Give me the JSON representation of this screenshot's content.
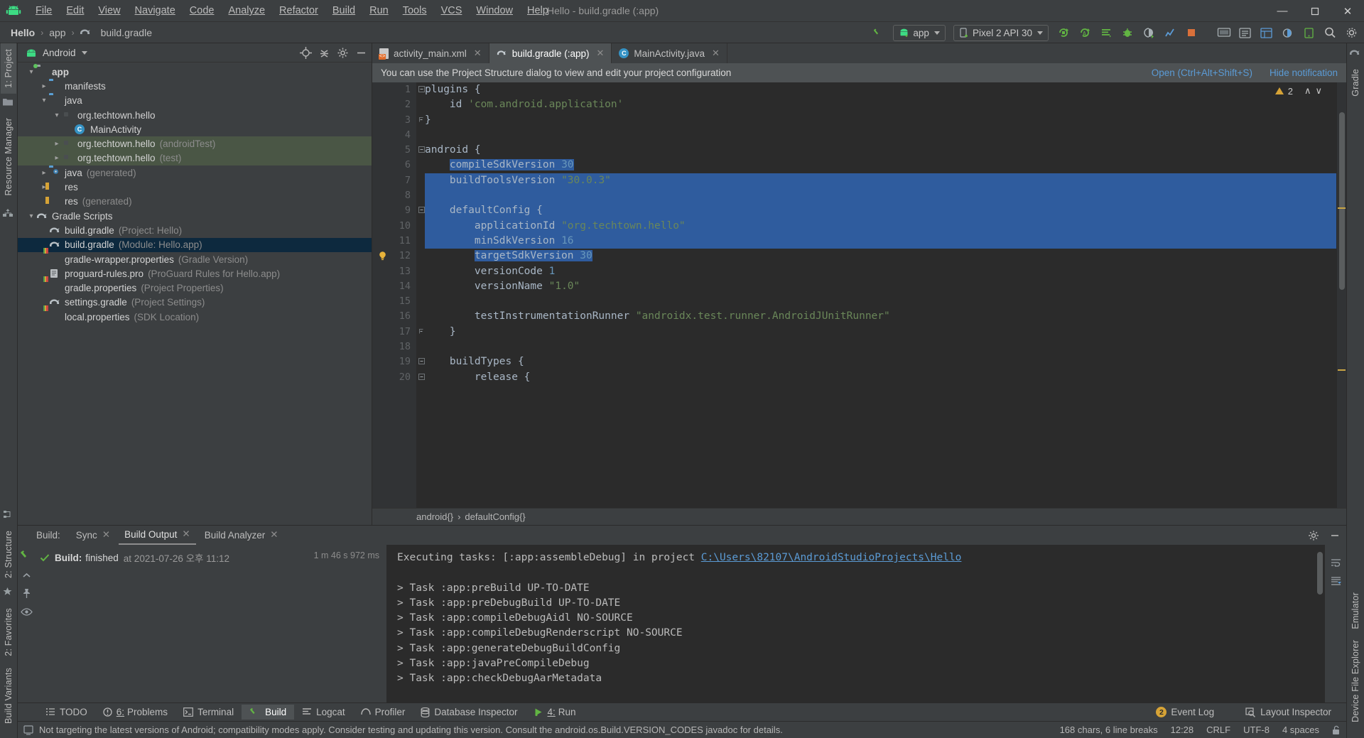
{
  "window": {
    "title": "Hello - build.gradle (:app)",
    "minimize": "─",
    "maximize": "☐",
    "close": "✕"
  },
  "menubar": {
    "logo_icon": "android-logo-icon",
    "items": [
      {
        "label": "File",
        "mnemonic": "F"
      },
      {
        "label": "Edit",
        "mnemonic": "E"
      },
      {
        "label": "View",
        "mnemonic": "V"
      },
      {
        "label": "Navigate",
        "mnemonic": "N"
      },
      {
        "label": "Code",
        "mnemonic": "C"
      },
      {
        "label": "Analyze",
        "mnemonic": "y"
      },
      {
        "label": "Refactor",
        "mnemonic": "R"
      },
      {
        "label": "Build",
        "mnemonic": "B"
      },
      {
        "label": "Run",
        "mnemonic": "u"
      },
      {
        "label": "Tools",
        "mnemonic": "T"
      },
      {
        "label": "VCS",
        "mnemonic": "S"
      },
      {
        "label": "Window",
        "mnemonic": "W"
      },
      {
        "label": "Help",
        "mnemonic": "H"
      }
    ]
  },
  "navbar": {
    "breadcrumbs": [
      {
        "label": "Hello",
        "icon": ""
      },
      {
        "label": "app",
        "icon": ""
      },
      {
        "label": "build.gradle",
        "icon": "gradle-icon"
      }
    ],
    "separator": "›",
    "module_selector": "app",
    "device_selector": "Pixel 2 API 30",
    "icons": [
      "make-project-icon",
      "run-icon",
      "debug-icon",
      "run-with-coverage-icon",
      "profiler-icon",
      "apply-changes-icon",
      "apply-code-changes-icon",
      "stop-icon",
      "avd-manager-icon",
      "sdk-manager-icon",
      "search-icon"
    ]
  },
  "left_strip": {
    "tabs": [
      {
        "label": "1: Project",
        "active": true
      },
      {
        "label": "Resource Manager",
        "active": false
      }
    ],
    "bottom_tabs": [
      {
        "label": "2: Structure"
      },
      {
        "label": "2: Favorites"
      },
      {
        "label": "Build Variants"
      }
    ]
  },
  "right_strip": {
    "tabs": [
      {
        "label": "Gradle"
      },
      {
        "label": "Emulator"
      },
      {
        "label": "Device File Explorer"
      }
    ]
  },
  "project_panel": {
    "scope": "Android",
    "scope_icon": "android-logo-icon",
    "header_icons": [
      "target-icon",
      "collapse-all-icon",
      "settings-gear-icon",
      "hide-icon"
    ],
    "tree": [
      {
        "indent": 0,
        "arrow": "down",
        "icon": "folder-module-icon",
        "label": "app",
        "bold": true,
        "sub": "",
        "state": "normal"
      },
      {
        "indent": 1,
        "arrow": "right",
        "icon": "folder-icon",
        "label": "manifests",
        "bold": false,
        "sub": "",
        "state": "normal"
      },
      {
        "indent": 1,
        "arrow": "down",
        "icon": "folder-icon",
        "label": "java",
        "bold": false,
        "sub": "",
        "state": "normal"
      },
      {
        "indent": 2,
        "arrow": "down",
        "icon": "package-icon",
        "label": "org.techtown.hello",
        "bold": false,
        "sub": "",
        "state": "normal"
      },
      {
        "indent": 3,
        "arrow": "none",
        "icon": "java-class-icon",
        "label": "MainActivity",
        "bold": false,
        "sub": "",
        "state": "normal"
      },
      {
        "indent": 2,
        "arrow": "right",
        "icon": "package-icon",
        "label": "org.techtown.hello",
        "bold": false,
        "sub": "(androidTest)",
        "state": "testsrc"
      },
      {
        "indent": 2,
        "arrow": "right",
        "icon": "package-icon",
        "label": "org.techtown.hello",
        "bold": false,
        "sub": "(test)",
        "state": "testsrc"
      },
      {
        "indent": 1,
        "arrow": "right",
        "icon": "folder-generated-icon",
        "label": "java",
        "bold": false,
        "sub": "(generated)",
        "state": "normal"
      },
      {
        "indent": 1,
        "arrow": "right",
        "icon": "res-folder-icon",
        "label": "res",
        "bold": false,
        "sub": "",
        "state": "normal"
      },
      {
        "indent": 1,
        "arrow": "none",
        "icon": "res-folder-icon",
        "label": "res",
        "bold": false,
        "sub": "(generated)",
        "state": "normal"
      },
      {
        "indent": 0,
        "arrow": "down",
        "icon": "gradle-icon",
        "label": "Gradle Scripts",
        "bold": false,
        "sub": "",
        "state": "normal"
      },
      {
        "indent": 1,
        "arrow": "none",
        "icon": "gradle-icon",
        "label": "build.gradle",
        "bold": false,
        "sub": "(Project: Hello)",
        "state": "normal"
      },
      {
        "indent": 1,
        "arrow": "none",
        "icon": "gradle-icon",
        "label": "build.gradle",
        "bold": false,
        "sub": "(Module: Hello.app)",
        "state": "selected"
      },
      {
        "indent": 1,
        "arrow": "none",
        "icon": "properties-icon",
        "label": "gradle-wrapper.properties",
        "bold": false,
        "sub": "(Gradle Version)",
        "state": "normal"
      },
      {
        "indent": 1,
        "arrow": "none",
        "icon": "proguard-icon",
        "label": "proguard-rules.pro",
        "bold": false,
        "sub": "(ProGuard Rules for Hello.app)",
        "state": "normal"
      },
      {
        "indent": 1,
        "arrow": "none",
        "icon": "properties-icon",
        "label": "gradle.properties",
        "bold": false,
        "sub": "(Project Properties)",
        "state": "normal"
      },
      {
        "indent": 1,
        "arrow": "none",
        "icon": "gradle-icon",
        "label": "settings.gradle",
        "bold": false,
        "sub": "(Project Settings)",
        "state": "normal"
      },
      {
        "indent": 1,
        "arrow": "none",
        "icon": "properties-icon",
        "label": "local.properties",
        "bold": false,
        "sub": "(SDK Location)",
        "state": "normal"
      }
    ]
  },
  "editor": {
    "tabs": [
      {
        "label": "activity_main.xml",
        "icon": "xml-layout-icon",
        "active": false
      },
      {
        "label": "build.gradle (:app)",
        "icon": "gradle-icon",
        "active": true
      },
      {
        "label": "MainActivity.java",
        "icon": "java-class-icon",
        "active": false
      }
    ],
    "close_glyph": "✕",
    "notification": {
      "text": "You can use the Project Structure dialog to view and edit your project configuration",
      "open_action": "Open (Ctrl+Alt+Shift+S)",
      "hide_action": "Hide notification"
    },
    "inspection": {
      "warning_count": "2",
      "up_glyph": "∧",
      "down_glyph": "∨"
    },
    "lines": [
      {
        "n": 1,
        "text": "plugins {",
        "fold": "open",
        "sel": false
      },
      {
        "n": 2,
        "text": "    id 'com.android.application'",
        "fold": "",
        "sel": false
      },
      {
        "n": 3,
        "text": "}",
        "fold": "close",
        "sel": false
      },
      {
        "n": 4,
        "text": "",
        "fold": "",
        "sel": false
      },
      {
        "n": 5,
        "text": "android {",
        "fold": "open",
        "sel": false
      },
      {
        "n": 6,
        "text": "    compileSdkVersion 30",
        "fold": "",
        "sel": true
      },
      {
        "n": 7,
        "text": "    buildToolsVersion \"30.0.3\"",
        "fold": "",
        "sel": true
      },
      {
        "n": 8,
        "text": "",
        "fold": "",
        "sel": true
      },
      {
        "n": 9,
        "text": "    defaultConfig {",
        "fold": "open",
        "sel": true
      },
      {
        "n": 10,
        "text": "        applicationId \"org.techtown.hello\"",
        "fold": "",
        "sel": true
      },
      {
        "n": 11,
        "text": "        minSdkVersion 16",
        "fold": "",
        "sel": true
      },
      {
        "n": 12,
        "text": "        targetSdkVersion 30",
        "fold": "",
        "sel": true,
        "bulb": true
      },
      {
        "n": 13,
        "text": "        versionCode 1",
        "fold": "",
        "sel": false
      },
      {
        "n": 14,
        "text": "        versionName \"1.0\"",
        "fold": "",
        "sel": false
      },
      {
        "n": 15,
        "text": "",
        "fold": "",
        "sel": false
      },
      {
        "n": 16,
        "text": "        testInstrumentationRunner \"androidx.test.runner.AndroidJUnitRunner\"",
        "fold": "",
        "sel": false
      },
      {
        "n": 17,
        "text": "    }",
        "fold": "close",
        "sel": false
      },
      {
        "n": 18,
        "text": "",
        "fold": "",
        "sel": false
      },
      {
        "n": 19,
        "text": "    buildTypes {",
        "fold": "open",
        "sel": false
      },
      {
        "n": 20,
        "text": "        release {",
        "fold": "open",
        "sel": false
      }
    ],
    "breadcrumbs": [
      "android{}",
      "defaultConfig{}"
    ],
    "breadcrumb_sep": "›"
  },
  "build_panel": {
    "title": "Build:",
    "tabs": [
      {
        "label": "Sync",
        "active": false,
        "closable": true
      },
      {
        "label": "Build Output",
        "active": true,
        "closable": true
      },
      {
        "label": "Build Analyzer",
        "active": false,
        "closable": true
      }
    ],
    "close_glyph": "✕",
    "header_icons": [
      "settings-gear-icon",
      "minimize-icon"
    ],
    "result": {
      "status_icon": "check-icon",
      "prefix": "Build:",
      "label": "finished",
      "detail": "at 2021-07-26 오후 11:12",
      "duration": "1 m 46 s 972 ms"
    },
    "side_icons": [
      "build-hammer-icon",
      "collapse-icon",
      "pin-icon",
      "eye-icon"
    ],
    "console": [
      {
        "text": "Executing tasks: [:app:assembleDebug] in project ",
        "url": "C:\\Users\\82107\\AndroidStudioProjects\\Hello"
      },
      {
        "text": "",
        "url": ""
      },
      {
        "text": "> Task :app:preBuild UP-TO-DATE",
        "url": ""
      },
      {
        "text": "> Task :app:preDebugBuild UP-TO-DATE",
        "url": ""
      },
      {
        "text": "> Task :app:compileDebugAidl NO-SOURCE",
        "url": ""
      },
      {
        "text": "> Task :app:compileDebugRenderscript NO-SOURCE",
        "url": ""
      },
      {
        "text": "> Task :app:generateDebugBuildConfig",
        "url": ""
      },
      {
        "text": "> Task :app:javaPreCompileDebug",
        "url": ""
      },
      {
        "text": "> Task :app:checkDebugAarMetadata",
        "url": ""
      }
    ],
    "console_right_icons": [
      "wrap-text-icon",
      "scroll-to-end-icon"
    ]
  },
  "bottom_bar": {
    "windows": [
      {
        "label": "TODO",
        "icon": "todo-icon",
        "active": false,
        "prefix": ""
      },
      {
        "label": "Problems",
        "icon": "problems-icon",
        "active": false,
        "prefix": "6:"
      },
      {
        "label": "Terminal",
        "icon": "terminal-icon",
        "active": false,
        "prefix": ""
      },
      {
        "label": "Build",
        "icon": "build-hammer-icon",
        "active": true,
        "prefix": ""
      },
      {
        "label": "Logcat",
        "icon": "logcat-icon",
        "active": false,
        "prefix": ""
      },
      {
        "label": "Profiler",
        "icon": "profiler-icon",
        "active": false,
        "prefix": ""
      },
      {
        "label": "Database Inspector",
        "icon": "database-icon",
        "active": false,
        "prefix": ""
      },
      {
        "label": "Run",
        "icon": "run-icon",
        "active": false,
        "prefix": "4:"
      }
    ],
    "right": [
      {
        "label": "Event Log",
        "icon": "event-log-icon",
        "badge": "2"
      },
      {
        "label": "Layout Inspector",
        "icon": "layout-inspector-icon",
        "badge": ""
      }
    ]
  },
  "status_bar": {
    "icon": "inspection-icon",
    "message": "Not targeting the latest versions of Android; compatibility modes apply. Consider testing and updating this version. Consult the android.os.Build.VERSION_CODES javadoc for details.",
    "right": [
      "168 chars, 6 line breaks",
      "12:28",
      "CRLF",
      "UTF-8",
      "4 spaces"
    ],
    "lock_icon": "unlocked-icon"
  },
  "colors": {
    "accent_blue": "#2f5c9e",
    "selection_tree": "#0d293e",
    "test_source": "#4a5645",
    "link": "#5b9bd5",
    "warning": "#d6a336",
    "success": "#4f9d4f",
    "string": "#6a8759",
    "number": "#6897bb",
    "background": "#3c3f41",
    "editor_bg": "#2b2b2b"
  }
}
